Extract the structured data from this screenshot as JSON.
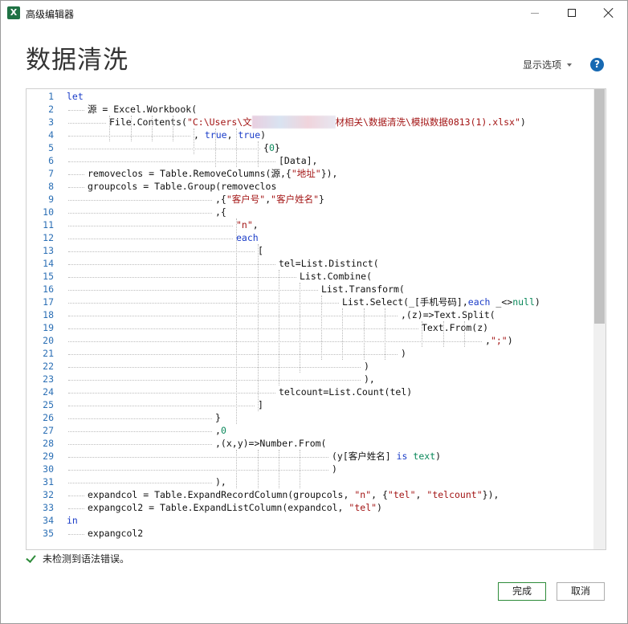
{
  "window": {
    "title": "高级编辑器",
    "app_icon": "excel-icon"
  },
  "header": {
    "title": "数据清洗",
    "options_label": "显示选项",
    "help_label": "?"
  },
  "status": {
    "text": "未检测到语法错误。"
  },
  "buttons": {
    "ok": "完成",
    "cancel": "取消"
  },
  "colors": {
    "keyword": "#1a3cc8",
    "string": "#a31515",
    "number": "#09885a",
    "line_number": "#2b6fb5",
    "ok_border": "#2e8b3a"
  },
  "code": {
    "line_numbers": [
      "1",
      "2",
      "3",
      "4",
      "5",
      "6",
      "7",
      "8",
      "9",
      "10",
      "11",
      "12",
      "13",
      "14",
      "15",
      "16",
      "17",
      "18",
      "19",
      "20",
      "21",
      "22",
      "23",
      "24",
      "25",
      "26",
      "27",
      "28",
      "29",
      "30",
      "31",
      "32",
      "33",
      "34",
      "35"
    ],
    "lines": [
      [
        {
          "t": "let",
          "c": "kw"
        }
      ],
      [
        {
          "t": "源 = Excel.Workbook(",
          "c": "tx"
        }
      ],
      [
        {
          "t": "File.Contents(",
          "c": "tx"
        },
        {
          "t": "\"C:\\Users\\文",
          "c": "str"
        },
        {
          "t": "               ",
          "c": "blur"
        },
        {
          "t": "材相关\\数据清洗\\模拟数据0813(1).xlsx\"",
          "c": "str"
        },
        {
          "t": ")",
          "c": "tx"
        }
      ],
      [
        {
          "t": ", ",
          "c": "tx"
        },
        {
          "t": "true",
          "c": "kw"
        },
        {
          "t": ", ",
          "c": "tx"
        },
        {
          "t": "true",
          "c": "kw"
        },
        {
          "t": ")",
          "c": "tx"
        }
      ],
      [
        {
          "t": "{",
          "c": "tx"
        },
        {
          "t": "0",
          "c": "num"
        },
        {
          "t": "}",
          "c": "tx"
        }
      ],
      [
        {
          "t": "[Data],",
          "c": "tx"
        }
      ],
      [
        {
          "t": "removeclos = Table.RemoveColumns(源,{",
          "c": "tx"
        },
        {
          "t": "\"地址\"",
          "c": "str"
        },
        {
          "t": "}),",
          "c": "tx"
        }
      ],
      [
        {
          "t": "groupcols = Table.Group(removeclos",
          "c": "tx"
        }
      ],
      [
        {
          "t": ",{",
          "c": "tx"
        },
        {
          "t": "\"客户号\"",
          "c": "str"
        },
        {
          "t": ",",
          "c": "tx"
        },
        {
          "t": "\"客户姓名\"",
          "c": "str"
        },
        {
          "t": "}",
          "c": "tx"
        }
      ],
      [
        {
          "t": ",{",
          "c": "tx"
        }
      ],
      [
        {
          "t": "\"n\"",
          "c": "str"
        },
        {
          "t": ",",
          "c": "tx"
        }
      ],
      [
        {
          "t": "each",
          "c": "kw"
        }
      ],
      [
        {
          "t": "[",
          "c": "tx"
        }
      ],
      [
        {
          "t": "tel=List.Distinct(",
          "c": "tx"
        }
      ],
      [
        {
          "t": "List.Combine(",
          "c": "tx"
        }
      ],
      [
        {
          "t": "List.Transform(",
          "c": "tx"
        }
      ],
      [
        {
          "t": "List.Select(_[手机号码],",
          "c": "tx"
        },
        {
          "t": "each",
          "c": "kw"
        },
        {
          "t": " _<>",
          "c": "tx"
        },
        {
          "t": "null",
          "c": "num"
        },
        {
          "t": ")",
          "c": "tx"
        }
      ],
      [
        {
          "t": ",(z)=>Text.Split(",
          "c": "tx"
        }
      ],
      [
        {
          "t": "Text.From(z)",
          "c": "tx"
        }
      ],
      [
        {
          "t": ",",
          "c": "tx"
        },
        {
          "t": "\";\"",
          "c": "str"
        },
        {
          "t": ")",
          "c": "tx"
        }
      ],
      [
        {
          "t": ")",
          "c": "tx"
        }
      ],
      [
        {
          "t": ")",
          "c": "tx"
        }
      ],
      [
        {
          "t": "),",
          "c": "tx"
        }
      ],
      [
        {
          "t": "telcount=List.Count(tel)",
          "c": "tx"
        }
      ],
      [
        {
          "t": "]",
          "c": "tx"
        }
      ],
      [
        {
          "t": "}",
          "c": "tx"
        }
      ],
      [
        {
          "t": ",",
          "c": "tx"
        },
        {
          "t": "0",
          "c": "num"
        }
      ],
      [
        {
          "t": ",(x,y)=>Number.From(",
          "c": "tx"
        }
      ],
      [
        {
          "t": "(y[客户姓名] ",
          "c": "tx"
        },
        {
          "t": "is",
          "c": "kw"
        },
        {
          "t": " ",
          "c": "tx"
        },
        {
          "t": "text",
          "c": "num"
        },
        {
          "t": ")",
          "c": "tx"
        }
      ],
      [
        {
          "t": ")",
          "c": "tx"
        }
      ],
      [
        {
          "t": "),",
          "c": "tx"
        }
      ],
      [
        {
          "t": "expandcol = Table.ExpandRecordColumn(groupcols, ",
          "c": "tx"
        },
        {
          "t": "\"n\"",
          "c": "str"
        },
        {
          "t": ", {",
          "c": "tx"
        },
        {
          "t": "\"tel\"",
          "c": "str"
        },
        {
          "t": ", ",
          "c": "tx"
        },
        {
          "t": "\"telcount\"",
          "c": "str"
        },
        {
          "t": "}),",
          "c": "tx"
        }
      ],
      [
        {
          "t": "expangcol2 = Table.ExpandListColumn(expandcol, ",
          "c": "tx"
        },
        {
          "t": "\"tel\"",
          "c": "str"
        },
        {
          "t": ")",
          "c": "tx"
        }
      ],
      [
        {
          "t": "in",
          "c": "kw"
        }
      ],
      [
        {
          "t": "expangcol2",
          "c": "tx"
        }
      ]
    ]
  }
}
